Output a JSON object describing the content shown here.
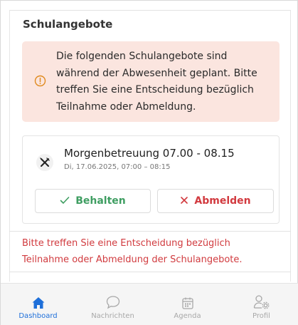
{
  "section": {
    "title": "Schulangebote"
  },
  "notice": {
    "icon": "info-circle-icon",
    "line1": "Die folgenden Schulangebote sind",
    "line2": "während der Abwesenheit geplant. Bitte",
    "line3": "treffen Sie eine Entscheidung bezüglich",
    "line4": "Teilnahme oder Abmeldung.",
    "color_bg": "#fbe5df",
    "color_icon": "#e08a1e"
  },
  "offer": {
    "icon": "fork-knife-icon",
    "title": "Morgenbetreuung 07.00 - 08.15",
    "subtitle": "Di, 17.06.2025, 07:00 – 08:15",
    "keep_label": "Behalten",
    "cancel_label": "Abmelden",
    "color_keep": "#3f9e62",
    "color_cancel": "#d23a3f"
  },
  "warning": {
    "line1": "Bitte treffen Sie eine Entscheidung bezüglich",
    "line2": "Teilnahme oder Abmeldung der Schulangebote."
  },
  "tabbar": {
    "tabs": [
      {
        "label": "Dashboard",
        "icon": "home-icon",
        "active": true
      },
      {
        "label": "Nachrichten",
        "icon": "chat-bubble-icon",
        "active": false
      },
      {
        "label": "Agenda",
        "icon": "calendar-icon",
        "active": false
      },
      {
        "label": "Profil",
        "icon": "user-settings-icon",
        "active": false
      }
    ],
    "color_active": "#1e6fd9"
  }
}
